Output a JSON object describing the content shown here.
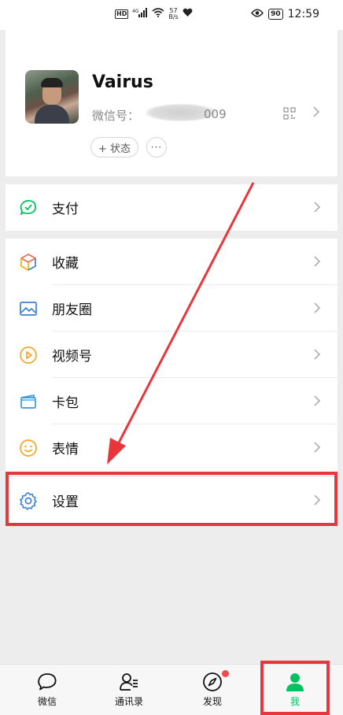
{
  "status_bar": {
    "hd": "HD",
    "signal": "4G",
    "net_speed_value": "57",
    "net_speed_unit": "B/s",
    "battery": "90",
    "time": "12:59"
  },
  "profile": {
    "name": "Vairus",
    "wechat_id_label": "微信号：",
    "wechat_id_suffix": "009",
    "status_button": "+ 状态",
    "more_button": "···"
  },
  "menu": {
    "pay": "支付",
    "favorites": "收藏",
    "moments": "朋友圈",
    "channels": "视频号",
    "cards": "卡包",
    "stickers": "表情",
    "settings": "设置"
  },
  "tabs": {
    "chats": "微信",
    "contacts": "通讯录",
    "discover": "发现",
    "me": "我"
  },
  "colors": {
    "accent": "#07c160",
    "annotation": "#e8363d",
    "icon_blue": "#3b82d6",
    "icon_orange": "#f5a623"
  }
}
